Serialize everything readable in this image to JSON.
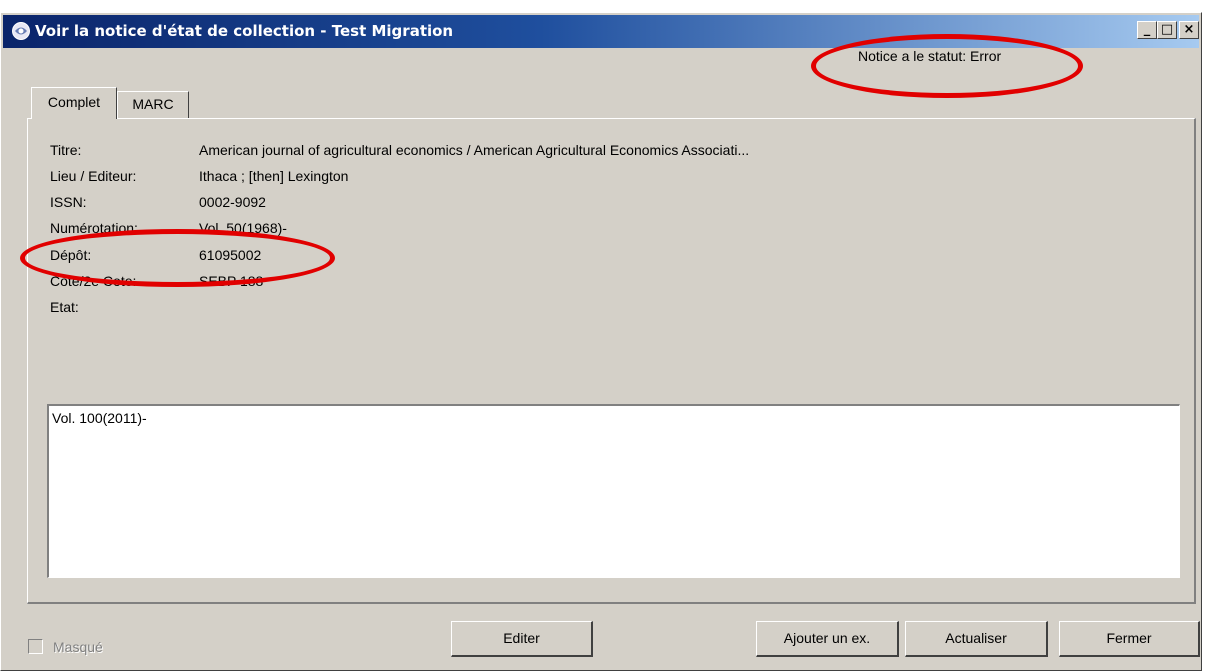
{
  "window": {
    "title": "Voir la notice d'état de collection - Test Migration",
    "minimize_glyph": "_",
    "maximize_glyph": "□",
    "close_glyph": "×"
  },
  "status": {
    "text": "Notice a le statut: Error"
  },
  "tabs": [
    {
      "label": "Complet",
      "active": true
    },
    {
      "label": "MARC",
      "active": false
    }
  ],
  "fields": [
    {
      "label": "Titre:",
      "value": "American journal of agricultural economics / American Agricultural Economics Associati..."
    },
    {
      "label": "Lieu / Editeur:",
      "value": "Ithaca ; [then] Lexington"
    },
    {
      "label": "ISSN:",
      "value": "0002-9092"
    },
    {
      "label": "Numérotation:",
      "value": "Vol. 50(1968)-"
    },
    {
      "label": "Dépôt:",
      "value": "61095002"
    },
    {
      "label": "Cote/2e Cote:",
      "value": "SEBP 188"
    },
    {
      "label": "Etat:",
      "value": ""
    }
  ],
  "holdings_text": "Vol. 100(2011)-",
  "checkbox": {
    "label": "Masqué",
    "checked": false,
    "enabled": false
  },
  "buttons": {
    "edit": "Editer",
    "add_item": "Ajouter un ex.",
    "refresh": "Actualiser",
    "close": "Fermer"
  },
  "colors": {
    "annotation": "#e10000",
    "titlebar_start": "#0a246a",
    "titlebar_end": "#a6caf0",
    "window_bg": "#d4d0c8"
  }
}
